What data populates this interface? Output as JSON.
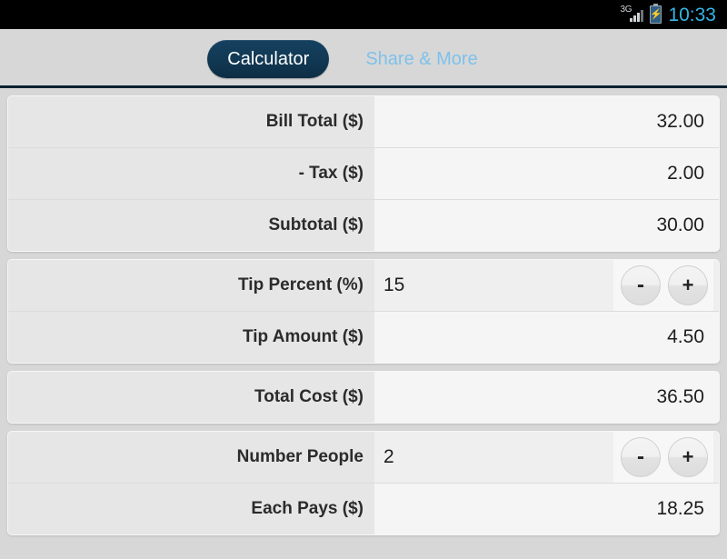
{
  "status_bar": {
    "network": "3G",
    "network_icon": "signal-bars-icon",
    "battery_icon": "battery-charging-icon",
    "time": "10:33",
    "time_color": "#33b5e5"
  },
  "tab_bar": {
    "tabs": [
      {
        "label": "Calculator",
        "active": true
      },
      {
        "label": "Share & More",
        "active": false
      }
    ],
    "active_text_color": "#ffffff",
    "inactive_text_color": "#7ec1ea",
    "background_top": "#1b5b8c",
    "background_bottom": "#072b44"
  },
  "cards": [
    {
      "rows": [
        {
          "label": "Bill Total ($)",
          "value": "32.00",
          "editable": false
        },
        {
          "label": "- Tax ($)",
          "value": "2.00",
          "editable": false
        },
        {
          "label": "Subtotal ($)",
          "value": "30.00",
          "editable": false
        }
      ]
    },
    {
      "rows": [
        {
          "label": "Tip Percent (%)",
          "value": "15",
          "editable": true,
          "minus_label": "-",
          "plus_label": "+"
        },
        {
          "label": "Tip Amount ($)",
          "value": "4.50",
          "editable": false
        }
      ]
    },
    {
      "rows": [
        {
          "label": "Total Cost ($)",
          "value": "36.50",
          "editable": false
        }
      ]
    },
    {
      "rows": [
        {
          "label": "Number People",
          "value": "2",
          "editable": true,
          "minus_label": "-",
          "plus_label": "+"
        },
        {
          "label": "Each Pays ($)",
          "value": "18.25",
          "editable": false
        }
      ]
    }
  ]
}
